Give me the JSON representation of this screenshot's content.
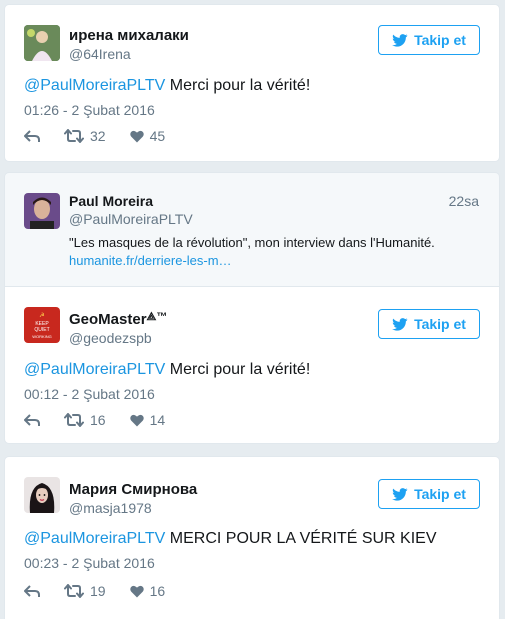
{
  "follow_label": "Takip et",
  "tweets": [
    {
      "name": "ирена михалаки",
      "handle": "@64Irena",
      "mention": "@PaulMoreiraPLTV",
      "text": " Merci pour la vérité!",
      "timestamp": "01:26 - 2 Şubat 2016",
      "retweets": "32",
      "likes": "45"
    },
    {
      "name": "GeoMaster",
      "name_suffix": "⟁™",
      "handle": "@geodezspb",
      "mention": "@PaulMoreiraPLTV",
      "text": " Merci pour la vérité!",
      "timestamp": "00:12 - 2 Şubat 2016",
      "retweets": "16",
      "likes": "14"
    },
    {
      "name": "Мария Смирнова",
      "handle": "@masja1978",
      "mention": "@PaulMoreiraPLTV",
      "text": " MERCI POUR LA VÉRITÉ SUR KIEV",
      "timestamp": "00:23 - 2 Şubat 2016",
      "retweets": "19",
      "likes": "16"
    }
  ],
  "quoted": {
    "name": "Paul Moreira",
    "handle": "@PaulMoreiraPLTV",
    "time": "22sa",
    "text": "\"Les masques de la révolution\", mon interview dans l'Humanité.",
    "link": "humanite.fr/derriere-les-m…"
  },
  "colors": {
    "accent": "#1da1f2",
    "link": "#1b95e0",
    "muted": "#657786"
  },
  "icons": [
    "twitter-bird-icon",
    "reply-icon",
    "retweet-icon",
    "heart-icon"
  ]
}
